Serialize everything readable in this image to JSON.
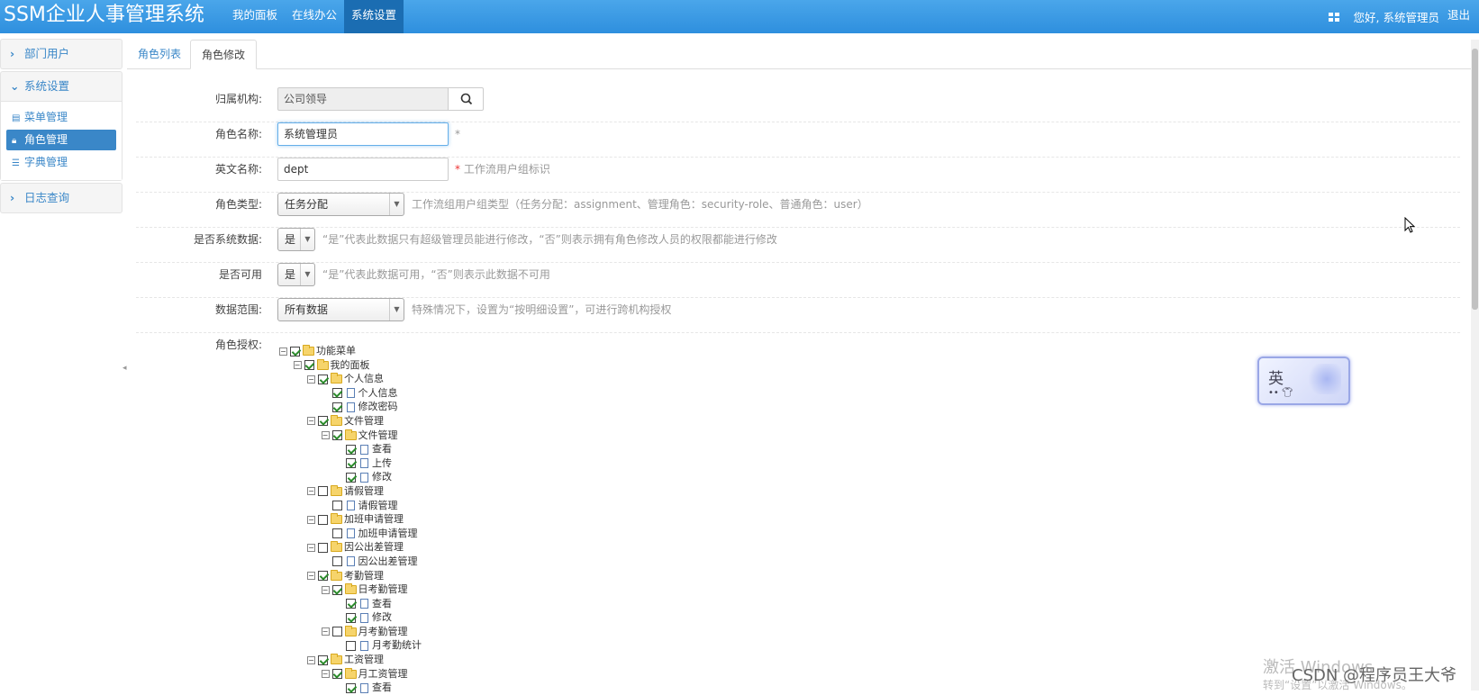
{
  "app": {
    "title": "SSM企业人事管理系统"
  },
  "topnav": {
    "items": [
      {
        "label": "我的面板"
      },
      {
        "label": "在线办公"
      },
      {
        "label": "系统设置",
        "active": true
      }
    ]
  },
  "user": {
    "greeting": "您好, 系统管理员",
    "logout": "退出"
  },
  "sidebar": {
    "sections": [
      {
        "label": "部门用户",
        "expanded": false
      },
      {
        "label": "系统设置",
        "expanded": true,
        "items": [
          {
            "label": "菜单管理",
            "icon": "table-icon"
          },
          {
            "label": "角色管理",
            "icon": "lock-icon",
            "active": true
          },
          {
            "label": "字典管理",
            "icon": "list-icon"
          }
        ]
      },
      {
        "label": "日志查询",
        "expanded": false
      }
    ]
  },
  "tabs": [
    {
      "label": "角色列表"
    },
    {
      "label": "角色修改",
      "active": true
    }
  ],
  "form": {
    "org": {
      "label": "归属机构:",
      "value": "公司领导"
    },
    "name": {
      "label": "角色名称:",
      "value": "系统管理员",
      "required": "*"
    },
    "enname": {
      "label": "英文名称:",
      "value": "dept",
      "help": "* 工作流用户组标识"
    },
    "roleType": {
      "label": "角色类型:",
      "value": "任务分配",
      "help": "工作流组用户组类型（任务分配：assignment、管理角色：security-role、普通角色：user）"
    },
    "sysData": {
      "label": "是否系统数据:",
      "value": "是",
      "help": "“是”代表此数据只有超级管理员能进行修改，“否”则表示拥有角色修改人员的权限都能进行修改"
    },
    "usable": {
      "label": "是否可用",
      "value": "是",
      "help": "“是”代表此数据可用，“否”则表示此数据不可用"
    },
    "dataScope": {
      "label": "数据范围:",
      "value": "所有数据",
      "help": "特殊情况下，设置为“按明细设置”，可进行跨机构授权"
    },
    "auth": {
      "label": "角色授权:"
    }
  },
  "tree": [
    {
      "label": "功能菜单",
      "level": 0,
      "checked": true,
      "type": "folder"
    },
    {
      "label": "我的面板",
      "level": 1,
      "checked": true,
      "type": "folder"
    },
    {
      "label": "个人信息",
      "level": 2,
      "checked": true,
      "type": "folder"
    },
    {
      "label": "个人信息",
      "level": 3,
      "checked": true,
      "type": "doc"
    },
    {
      "label": "修改密码",
      "level": 3,
      "checked": true,
      "type": "doc"
    },
    {
      "label": "文件管理",
      "level": 2,
      "checked": true,
      "type": "folder"
    },
    {
      "label": "文件管理",
      "level": 3,
      "checked": true,
      "type": "folder"
    },
    {
      "label": "查看",
      "level": 4,
      "checked": true,
      "type": "doc"
    },
    {
      "label": "上传",
      "level": 4,
      "checked": true,
      "type": "doc"
    },
    {
      "label": "修改",
      "level": 4,
      "checked": true,
      "type": "doc"
    },
    {
      "label": "请假管理",
      "level": 2,
      "checked": false,
      "type": "folder"
    },
    {
      "label": "请假管理",
      "level": 3,
      "checked": false,
      "type": "doc"
    },
    {
      "label": "加班申请管理",
      "level": 2,
      "checked": false,
      "type": "folder"
    },
    {
      "label": "加班申请管理",
      "level": 3,
      "checked": false,
      "type": "doc"
    },
    {
      "label": "因公出差管理",
      "level": 2,
      "checked": false,
      "type": "folder"
    },
    {
      "label": "因公出差管理",
      "level": 3,
      "checked": false,
      "type": "doc"
    },
    {
      "label": "考勤管理",
      "level": 2,
      "checked": true,
      "type": "folder"
    },
    {
      "label": "日考勤管理",
      "level": 3,
      "checked": true,
      "type": "folder"
    },
    {
      "label": "查看",
      "level": 4,
      "checked": true,
      "type": "doc"
    },
    {
      "label": "修改",
      "level": 4,
      "checked": true,
      "type": "doc"
    },
    {
      "label": "月考勤管理",
      "level": 3,
      "checked": false,
      "type": "folder"
    },
    {
      "label": "月考勤统计",
      "level": 4,
      "checked": false,
      "type": "doc"
    },
    {
      "label": "工资管理",
      "level": 2,
      "checked": true,
      "type": "folder"
    },
    {
      "label": "月工资管理",
      "level": 3,
      "checked": true,
      "type": "folder"
    },
    {
      "label": "查看",
      "level": 4,
      "checked": true,
      "type": "doc"
    }
  ],
  "overlay": {
    "ime_char": "英",
    "watermark_line1": "激活 Windows",
    "watermark_line2": "转到“设置”以激活 Windows。",
    "csdn": "CSDN @程序员王大爷"
  },
  "colors": {
    "navbar": "#2e8fde",
    "accent": "#3a87c8",
    "required": "#ee3333"
  }
}
